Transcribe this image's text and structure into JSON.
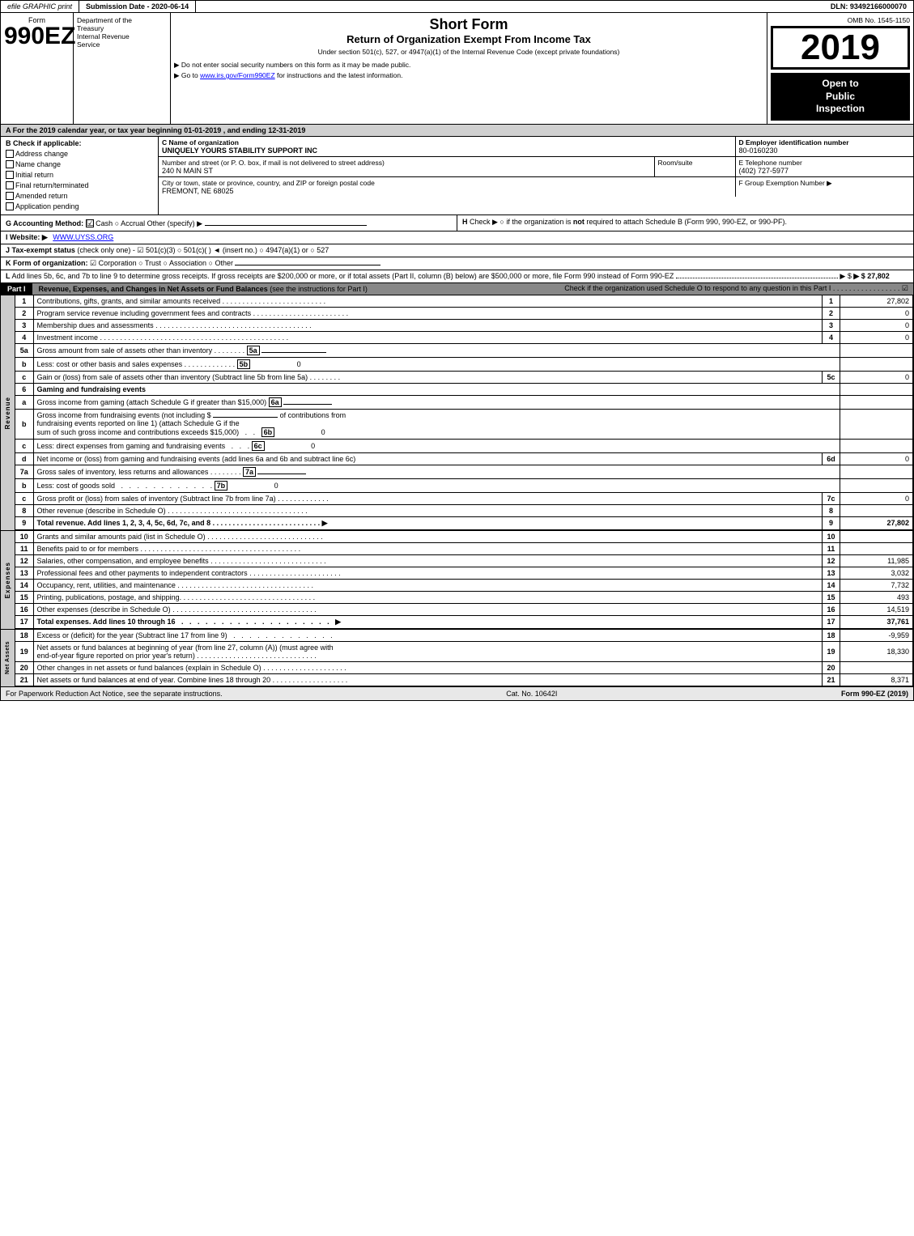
{
  "header": {
    "efile": "efile GRAPHIC print",
    "submission": "Submission Date - 2020-06-14",
    "dln": "DLN: 93492166000070"
  },
  "form": {
    "number": "990EZ",
    "title1": "Short Form",
    "title2": "Return of Organization Exempt From Income Tax",
    "subtitle": "Under section 501(c), 527, or 4947(a)(1) of the Internal Revenue Code (except private foundations)",
    "instruction1": "▶ Do not enter social security numbers on this form as it may be made public.",
    "instruction2": "▶ Go to www.irs.gov/Form990EZ for instructions and the latest information.",
    "omb": "OMB No. 1545-1150",
    "year": "2019",
    "open_label1": "Open to",
    "open_label2": "Public",
    "open_label3": "Inspection"
  },
  "dept": {
    "line1": "Department of the",
    "line2": "Treasury",
    "line3": "Internal Revenue",
    "line4": "Service"
  },
  "section_a": {
    "text": "A  For the 2019 calendar year, or tax year beginning 01-01-2019 , and ending 12-31-2019"
  },
  "section_b": {
    "label": "B  Check if applicable:",
    "checkboxes": [
      {
        "label": "Address change",
        "checked": false
      },
      {
        "label": "Name change",
        "checked": false
      },
      {
        "label": "Initial return",
        "checked": false
      },
      {
        "label": "Final return/terminated",
        "checked": false
      },
      {
        "label": "Amended return",
        "checked": false
      },
      {
        "label": "Application pending",
        "checked": false
      }
    ]
  },
  "org": {
    "name_label": "C Name of organization",
    "name": "UNIQUELY YOURS STABILITY SUPPORT INC",
    "ein_label": "D Employer identification number",
    "ein": "80-0160230",
    "street_label": "Number and street (or P. O. box, if mail is not delivered to street address)",
    "street": "240 N MAIN ST",
    "room_label": "Room/suite",
    "room": "",
    "phone_label": "E Telephone number",
    "phone": "(402) 727-5977",
    "city_label": "City or town, state or province, country, and ZIP or foreign postal code",
    "city": "FREMONT, NE  68025",
    "group_label": "F Group Exemption Number",
    "group": ""
  },
  "section_g": {
    "label": "G Accounting Method:",
    "cash": "Cash",
    "cash_checked": true,
    "accrual": "Accrual",
    "other": "Other (specify) ▶"
  },
  "section_h": {
    "text": "H  Check ▶  ○ if the organization is not required to attach Schedule B (Form 990, 990-EZ, or 990-PF)."
  },
  "section_i": {
    "label": "I Website: ▶",
    "url": "WWW.UYSS.ORG"
  },
  "section_j": {
    "text": "J Tax-exempt status (check only one) - ☑ 501(c)(3) ○ 501(c)(   ) ◄ (insert no.) ○ 4947(a)(1) or ○ 527"
  },
  "section_k": {
    "text": "K Form of organization:  ☑ Corporation   ○ Trust   ○ Association   ○ Other"
  },
  "section_l": {
    "text": "L Add lines 5b, 6c, and 7b to line 9 to determine gross receipts. If gross receipts are $200,000 or more, or if total assets (Part II, column (B) below) are $500,000 or more, file Form 990 instead of Form 990-EZ",
    "amount": "▶ $ 27,802"
  },
  "part1": {
    "header": "Part I",
    "title": "Revenue, Expenses, and Changes in Net Assets or Fund Balances",
    "subtitle": "(see the instructions for Part I)",
    "check_text": "Check if the organization used Schedule O to respond to any question in this Part I",
    "lines": [
      {
        "num": "1",
        "desc": "Contributions, gifts, grants, and similar amounts received",
        "amount": "27,802"
      },
      {
        "num": "2",
        "desc": "Program service revenue including government fees and contracts",
        "amount": "0"
      },
      {
        "num": "3",
        "desc": "Membership dues and assessments",
        "amount": "0"
      },
      {
        "num": "4",
        "desc": "Investment income",
        "amount": "0"
      },
      {
        "num": "5a",
        "desc": "Gross amount from sale of assets other than inventory",
        "box": "5a",
        "sub_amount": ""
      },
      {
        "num": "5b",
        "desc": "Less: cost or other basis and sales expenses",
        "box": "5b",
        "sub_amount": "0"
      },
      {
        "num": "5c",
        "desc": "Gain or (loss) from sale of assets other than inventory (Subtract line 5b from line 5a)",
        "amount": "0"
      },
      {
        "num": "6",
        "desc": "Gaming and fundraising events",
        "amount": ""
      },
      {
        "num": "6a",
        "desc": "Gross income from gaming (attach Schedule G if greater than $15,000)",
        "box": "6a",
        "sub_amount": ""
      },
      {
        "num": "6b",
        "desc": "Gross income from fundraising events (not including $_____ of contributions from fundraising events reported on line 1) (attach Schedule G if the sum of such gross income and contributions exceeds $15,000)",
        "box": "6b",
        "sub_amount": "0"
      },
      {
        "num": "6c",
        "desc": "Less: direct expenses from gaming and fundraising events",
        "box": "6c",
        "sub_amount": "0"
      },
      {
        "num": "6d",
        "desc": "Net income or (loss) from gaming and fundraising events (add lines 6a and 6b and subtract line 6c)",
        "amount": "0"
      },
      {
        "num": "7a",
        "desc": "Gross sales of inventory, less returns and allowances",
        "box": "7a",
        "sub_amount": ""
      },
      {
        "num": "7b",
        "desc": "Less: cost of goods sold",
        "box": "7b",
        "sub_amount": "0"
      },
      {
        "num": "7c",
        "desc": "Gross profit or (loss) from sales of inventory (Subtract line 7b from line 7a)",
        "amount": "0"
      },
      {
        "num": "8",
        "desc": "Other revenue (describe in Schedule O)",
        "amount": ""
      },
      {
        "num": "9",
        "desc": "Total revenue. Add lines 1, 2, 3, 4, 5c, 6d, 7c, and 8",
        "amount": "27,802",
        "bold": true
      }
    ]
  },
  "part1_expenses": {
    "lines": [
      {
        "num": "10",
        "desc": "Grants and similar amounts paid (list in Schedule O)",
        "amount": ""
      },
      {
        "num": "11",
        "desc": "Benefits paid to or for members",
        "amount": ""
      },
      {
        "num": "12",
        "desc": "Salaries, other compensation, and employee benefits",
        "amount": "11,985"
      },
      {
        "num": "13",
        "desc": "Professional fees and other payments to independent contractors",
        "amount": "3,032"
      },
      {
        "num": "14",
        "desc": "Occupancy, rent, utilities, and maintenance",
        "amount": "7,732"
      },
      {
        "num": "15",
        "desc": "Printing, publications, postage, and shipping",
        "amount": "493"
      },
      {
        "num": "16",
        "desc": "Other expenses (describe in Schedule O)",
        "amount": "14,519"
      },
      {
        "num": "17",
        "desc": "Total expenses. Add lines 10 through 16",
        "amount": "37,761",
        "bold": true
      }
    ]
  },
  "part1_net_assets": {
    "lines": [
      {
        "num": "18",
        "desc": "Excess or (deficit) for the year (Subtract line 17 from line 9)",
        "amount": "-9,959"
      },
      {
        "num": "19",
        "desc": "Net assets or fund balances at beginning of year (from line 27, column (A)) (must agree with end-of-year figure reported on prior year's return)",
        "amount": "18,330"
      },
      {
        "num": "20",
        "desc": "Other changes in net assets or fund balances (explain in Schedule O)",
        "amount": ""
      },
      {
        "num": "21",
        "desc": "Net assets or fund balances at end of year. Combine lines 18 through 20",
        "amount": "8,371"
      }
    ]
  },
  "footer": {
    "paperwork": "For Paperwork Reduction Act Notice, see the separate instructions.",
    "cat": "Cat. No. 10642I",
    "form": "Form 990-EZ (2019)"
  }
}
